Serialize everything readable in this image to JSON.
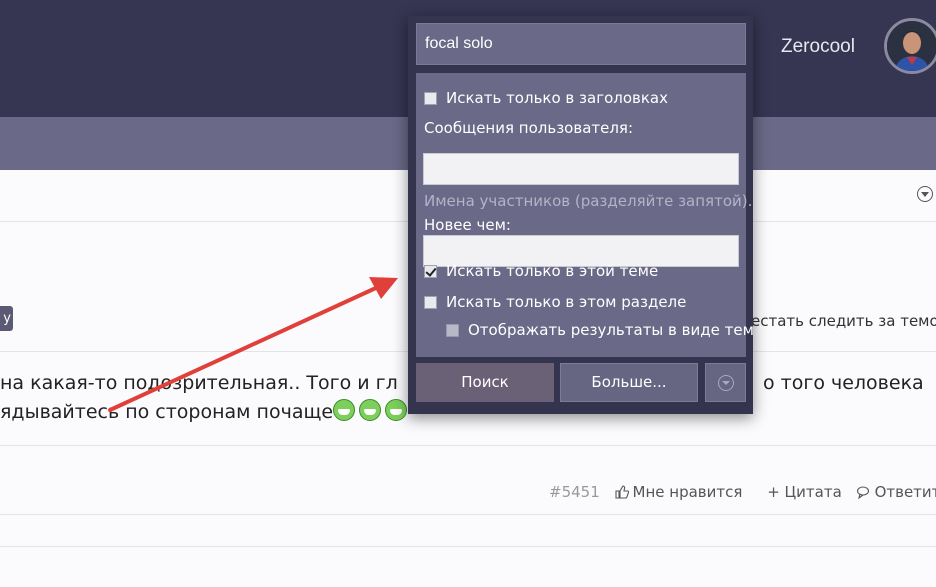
{
  "header": {
    "username": "Zerocool",
    "avatar_icon": "user-avatar"
  },
  "thread": {
    "tag_label": "у",
    "unwatch_label": "естать следить за темой",
    "post_line1": "на какая-то подозрительная.. Того и гл",
    "post_line1_tail": "о того человека",
    "post_line2": "ядывайтесь по сторонам почаще",
    "post_number": "#5451",
    "like_label": "Мне нравится",
    "quote_label": "+ Цитата",
    "reply_label": "Ответить"
  },
  "search_popup": {
    "query": "focal solo",
    "titles_only_label": "Искать только в заголовках",
    "titles_only_checked": false,
    "posted_by_label": "Сообщения пользователя:",
    "posted_by_value": "",
    "posted_by_hint": "Имена участников (разделяйте запятой).",
    "newer_than_label": "Новее чем:",
    "newer_than_value": "",
    "this_thread_label": "Искать только в этой теме",
    "this_thread_checked": true,
    "this_forum_label": "Искать только в этом разделе",
    "this_forum_checked": false,
    "display_results_label": "Отображать результаты в виде тем",
    "display_results_checked": false,
    "search_button": "Поиск",
    "more_button": "Больше..."
  },
  "colors": {
    "header_bg": "#363552",
    "subbar_bg": "#6a6987",
    "popup_bg": "#35344f",
    "arrow": "#e0403a"
  }
}
